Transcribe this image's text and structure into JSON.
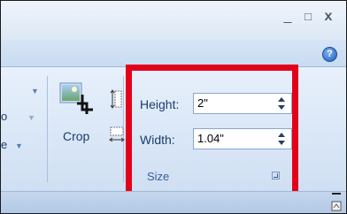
{
  "window_controls": {
    "minimize": "_",
    "maximize": "□",
    "close": "x"
  },
  "help_button": {
    "label": "?"
  },
  "partial_left": {
    "line1_arrow": "▼",
    "line2": "o",
    "line2_arrow": "▼",
    "line3": "e",
    "line3_arrow": "▼"
  },
  "crop": {
    "label": "Crop"
  },
  "size_group": {
    "label": "Size",
    "height": {
      "label": "Height:",
      "value": "2\""
    },
    "width": {
      "label": "Width:",
      "value": "1.04\""
    }
  },
  "colors": {
    "highlight_border": "#e3001b",
    "ribbon_bg": "#dae7f7",
    "label_text": "#1c3d6e",
    "group_label": "#3a5f99"
  }
}
